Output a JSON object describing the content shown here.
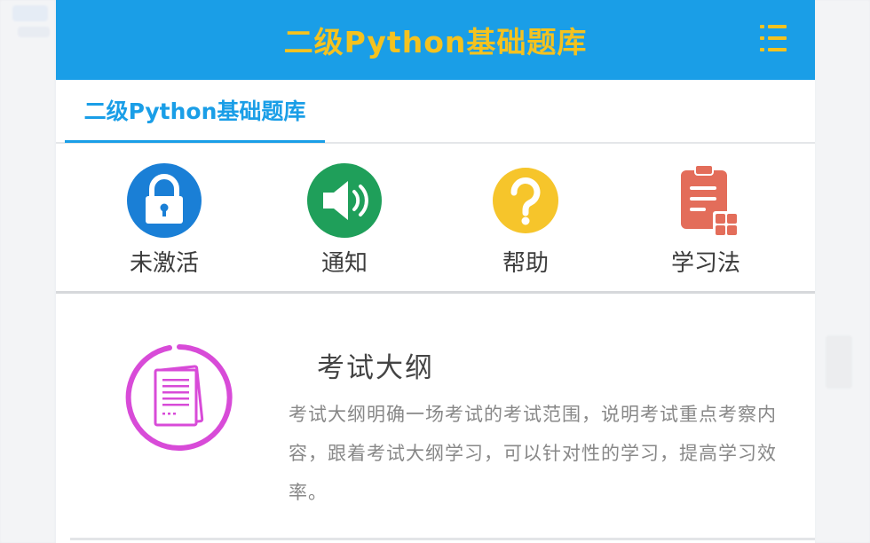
{
  "header": {
    "title": "二级Python基础题库",
    "menu_icon": "list-menu-icon"
  },
  "tabs": [
    {
      "label": "二级Python基础题库",
      "active": true
    }
  ],
  "quick_actions": [
    {
      "label": "未激活",
      "icon": "lock-icon",
      "color": "#1a7fd6"
    },
    {
      "label": "通知",
      "icon": "speaker-icon",
      "color": "#1f9f5a"
    },
    {
      "label": "帮助",
      "icon": "question-icon",
      "color": "#f6c52b"
    },
    {
      "label": "学习法",
      "icon": "clipboard-icon",
      "color": "#e36d5a"
    }
  ],
  "feature_card": {
    "title": "考试大纲",
    "description": "考试大纲明确一场考试的考试范围，说明考试重点考察内容，跟着考试大纲学习，可以针对性的学习，提高学习效率。",
    "icon": "document-icon",
    "icon_color": "#d84bd8"
  },
  "colors": {
    "header_bg": "#1a9ee7",
    "title_yellow": "#f4c21f",
    "accent_blue": "#1a9ee7"
  }
}
